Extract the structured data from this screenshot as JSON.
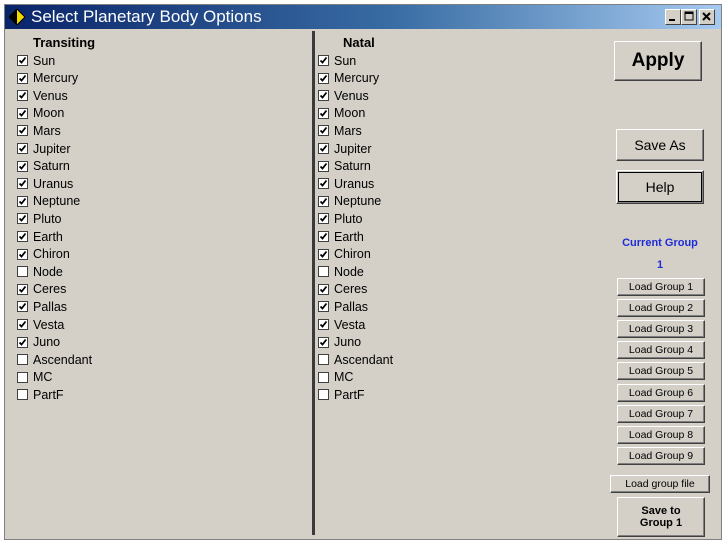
{
  "window": {
    "title": "Select Planetary Body Options",
    "controls": {
      "minimize": "minimize",
      "maximize": "maximize",
      "close": "close"
    }
  },
  "transiting": {
    "header": "Transiting",
    "items": [
      {
        "label": "Sun",
        "checked": true
      },
      {
        "label": "Mercury",
        "checked": true
      },
      {
        "label": "Venus",
        "checked": true
      },
      {
        "label": "Moon",
        "checked": true
      },
      {
        "label": "Mars",
        "checked": true
      },
      {
        "label": "Jupiter",
        "checked": true
      },
      {
        "label": "Saturn",
        "checked": true
      },
      {
        "label": "Uranus",
        "checked": true
      },
      {
        "label": "Neptune",
        "checked": true
      },
      {
        "label": "Pluto",
        "checked": true
      },
      {
        "label": "Earth",
        "checked": true
      },
      {
        "label": "Chiron",
        "checked": true
      },
      {
        "label": "Node",
        "checked": false
      },
      {
        "label": "Ceres",
        "checked": true
      },
      {
        "label": "Pallas",
        "checked": true
      },
      {
        "label": "Vesta",
        "checked": true
      },
      {
        "label": "Juno",
        "checked": true
      },
      {
        "label": "Ascendant",
        "checked": false
      },
      {
        "label": "MC",
        "checked": false
      },
      {
        "label": "PartF",
        "checked": false
      }
    ]
  },
  "natal": {
    "header": "Natal",
    "items": [
      {
        "label": "Sun",
        "checked": true
      },
      {
        "label": "Mercury",
        "checked": true
      },
      {
        "label": "Venus",
        "checked": true
      },
      {
        "label": "Moon",
        "checked": true
      },
      {
        "label": "Mars",
        "checked": true
      },
      {
        "label": "Jupiter",
        "checked": true
      },
      {
        "label": "Saturn",
        "checked": true
      },
      {
        "label": "Uranus",
        "checked": true
      },
      {
        "label": "Neptune",
        "checked": true
      },
      {
        "label": "Pluto",
        "checked": true
      },
      {
        "label": "Earth",
        "checked": true
      },
      {
        "label": "Chiron",
        "checked": true
      },
      {
        "label": "Node",
        "checked": false
      },
      {
        "label": "Ceres",
        "checked": true
      },
      {
        "label": "Pallas",
        "checked": true
      },
      {
        "label": "Vesta",
        "checked": true
      },
      {
        "label": "Juno",
        "checked": true
      },
      {
        "label": "Ascendant",
        "checked": false
      },
      {
        "label": "MC",
        "checked": false
      },
      {
        "label": "PartF",
        "checked": false
      }
    ]
  },
  "buttons": {
    "apply": "Apply",
    "save_as": "Save As",
    "help": "Help",
    "load_groups": [
      "Load Group 1",
      "Load Group 2",
      "Load Group 3",
      "Load Group 4",
      "Load Group 5",
      "Load Group 6",
      "Load Group 7",
      "Load Group 8",
      "Load Group 9"
    ],
    "load_group_file": "Load group file",
    "save_to_group_line1": "Save to",
    "save_to_group_line2": "Group 1"
  },
  "current_group": {
    "label": "Current Group",
    "value": "1"
  },
  "colors": {
    "title_bar": "#0a246a",
    "current_group_text": "#1e2bd8",
    "face": "#d4d0c8"
  }
}
